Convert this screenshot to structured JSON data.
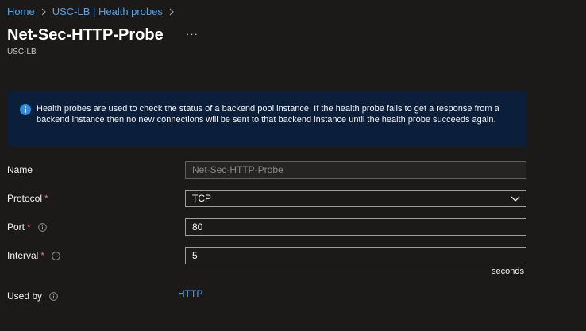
{
  "breadcrumb": {
    "items": [
      "Home",
      "USC-LB | Health probes"
    ]
  },
  "page": {
    "title": "Net-Sec-HTTP-Probe",
    "subtitle": "USC-LB",
    "more_label": "···"
  },
  "info": {
    "text": "Health probes are used to check the status of a backend pool instance. If the health probe fails to get a response from a backend instance then no new connections will be sent to that backend instance until the health probe succeeds again."
  },
  "form": {
    "name": {
      "label": "Name",
      "value": "Net-Sec-HTTP-Probe"
    },
    "protocol": {
      "label": "Protocol",
      "required_mark": "*",
      "value": "TCP"
    },
    "port": {
      "label": "Port",
      "required_mark": "*",
      "value": "80"
    },
    "interval": {
      "label": "Interval",
      "required_mark": "*",
      "value": "5",
      "unit": "seconds"
    },
    "used_by": {
      "label": "Used by",
      "value": "HTTP"
    }
  },
  "colors": {
    "background": "#1b1a19",
    "link": "#4ea3ee",
    "required": "#f1707b",
    "info_background": "#0b1e3a",
    "info_icon": "#2f8ce5"
  },
  "icons": {
    "breadcrumb_separator": "chevron-right-icon",
    "info": "info-icon",
    "help": "info-circle-icon",
    "dropdown": "chevron-down-icon"
  }
}
